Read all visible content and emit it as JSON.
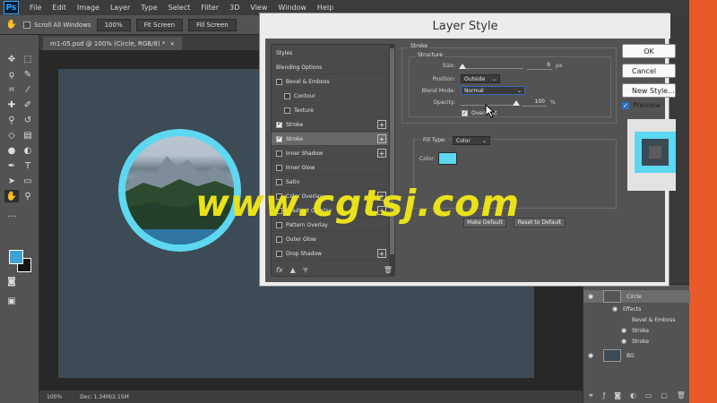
{
  "menubar": {
    "logo": "Ps",
    "items": [
      "File",
      "Edit",
      "Image",
      "Layer",
      "Type",
      "Select",
      "Filter",
      "3D",
      "View",
      "Window",
      "Help"
    ]
  },
  "optionsbar": {
    "scroll_all_windows": "Scroll All Windows",
    "zoom_100": "100%",
    "fit_screen": "Fit Screen",
    "fill_screen": "Fill Screen"
  },
  "document": {
    "tab_title": "m1-05.psd @ 100% (Circle, RGB/8) *",
    "tab_close": "×"
  },
  "statusbar": {
    "zoom": "100%",
    "doc_info": "Doc: 1.34M/2.15M"
  },
  "dialog": {
    "title": "Layer Style",
    "styles_header": "Styles",
    "styles": [
      {
        "label": "Blending Options",
        "checkbox": false,
        "plus": false,
        "checked": false,
        "indent": false
      },
      {
        "label": "Bevel & Emboss",
        "checkbox": true,
        "plus": false,
        "checked": false,
        "indent": false
      },
      {
        "label": "Contour",
        "checkbox": true,
        "plus": false,
        "checked": false,
        "indent": true
      },
      {
        "label": "Texture",
        "checkbox": true,
        "plus": false,
        "checked": false,
        "indent": true
      },
      {
        "label": "Stroke",
        "checkbox": true,
        "plus": true,
        "checked": true,
        "indent": false
      },
      {
        "label": "Stroke",
        "checkbox": true,
        "plus": true,
        "checked": true,
        "indent": false
      },
      {
        "label": "Inner Shadow",
        "checkbox": true,
        "plus": true,
        "checked": false,
        "indent": false
      },
      {
        "label": "Inner Glow",
        "checkbox": true,
        "plus": false,
        "checked": false,
        "indent": false
      },
      {
        "label": "Satin",
        "checkbox": true,
        "plus": false,
        "checked": false,
        "indent": false
      },
      {
        "label": "Color Overlay",
        "checkbox": true,
        "plus": true,
        "checked": false,
        "indent": false
      },
      {
        "label": "Gradient Overlay",
        "checkbox": true,
        "plus": true,
        "checked": false,
        "indent": false
      },
      {
        "label": "Pattern Overlay",
        "checkbox": true,
        "plus": false,
        "checked": false,
        "indent": false
      },
      {
        "label": "Outer Glow",
        "checkbox": true,
        "plus": false,
        "checked": false,
        "indent": false
      },
      {
        "label": "Drop Shadow",
        "checkbox": true,
        "plus": true,
        "checked": false,
        "indent": false
      }
    ],
    "selected_style_index": 5,
    "footer_fx": "fx",
    "stroke": {
      "group_title": "Stroke",
      "structure_title": "Structure",
      "size_label": "Size:",
      "size_value": "9",
      "size_unit": "px",
      "size_fraction": 0.03,
      "position_label": "Position:",
      "position_value": "Outside",
      "blend_label": "Blend Mode:",
      "blend_value": "Normal",
      "opacity_label": "Opacity:",
      "opacity_value": "100",
      "opacity_unit": "%",
      "opacity_fraction": 1.0,
      "overprint_label": "Overprint",
      "fill_type_label": "Fill Type:",
      "fill_type_value": "Color",
      "color_label": "Color:",
      "color_hex": "#5ed7f0",
      "make_default": "Make Default",
      "reset_default": "Reset to Default"
    },
    "buttons": {
      "ok": "OK",
      "cancel": "Cancel",
      "new_style": "New Style...",
      "preview": "Preview"
    }
  },
  "layers": {
    "rows": [
      {
        "name": "Circle",
        "type": "layer"
      },
      {
        "name": "Effects",
        "type": "effects"
      },
      {
        "name": "Bevel & Emboss",
        "type": "effect"
      },
      {
        "name": "Stroke",
        "type": "effect"
      },
      {
        "name": "Stroke",
        "type": "effect"
      },
      {
        "name": "BG",
        "type": "layer"
      }
    ]
  },
  "watermark": "www.cgtsj.com",
  "colors": {
    "accent_stroke": "#5ed7f0",
    "foreground": "#3fa3d6",
    "canvas_bg": "#3c4b55",
    "orange_bar": "#e85a28"
  }
}
